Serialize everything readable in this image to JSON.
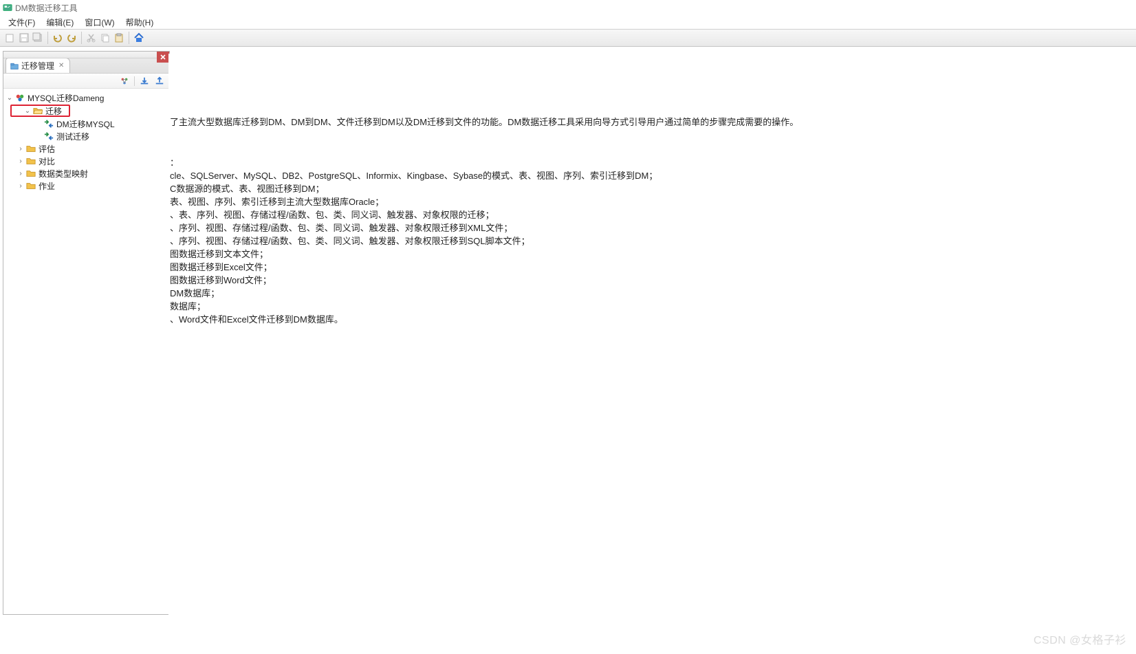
{
  "window": {
    "title": "DM数据迁移工具"
  },
  "menu": {
    "file": "文件(F)",
    "edit": "编辑(E)",
    "window": "窗口(W)",
    "help": "帮助(H)"
  },
  "sidebar": {
    "tab_label": "迁移管理",
    "tree": {
      "root": "MYSQL迁移Dameng",
      "migrate_folder": "迁移",
      "child_dm_mysql": "DM迁移MYSQL",
      "child_test": "测试迁移",
      "evaluate": "评估",
      "compare": "对比",
      "type_map": "数据类型映射",
      "jobs": "作业"
    }
  },
  "content": {
    "lines": [
      "了主流大型数据库迁移到DM、DM到DM、文件迁移到DM以及DM迁移到文件的功能。DM数据迁移工具采用向导方式引导用户通过简单的步骤完成需要的操作。",
      "：",
      "cle、SQLServer、MySQL、DB2、PostgreSQL、Informix、Kingbase、Sybase的模式、表、视图、序列、索引迁移到DM；",
      "C数据源的模式、表、视图迁移到DM；",
      "表、视图、序列、索引迁移到主流大型数据库Oracle；",
      "、表、序列、视图、存储过程/函数、包、类、同义词、触发器、对象权限的迁移；",
      "、序列、视图、存储过程/函数、包、类、同义词、触发器、对象权限迁移到XML文件；",
      "、序列、视图、存储过程/函数、包、类、同义词、触发器、对象权限迁移到SQL脚本文件；",
      "图数据迁移到文本文件；",
      "图数据迁移到Excel文件；",
      "图数据迁移到Word文件；",
      "DM数据库；",
      "数据库；",
      "、Word文件和Excel文件迁移到DM数据库。"
    ]
  },
  "watermark": "CSDN @女格子衫"
}
